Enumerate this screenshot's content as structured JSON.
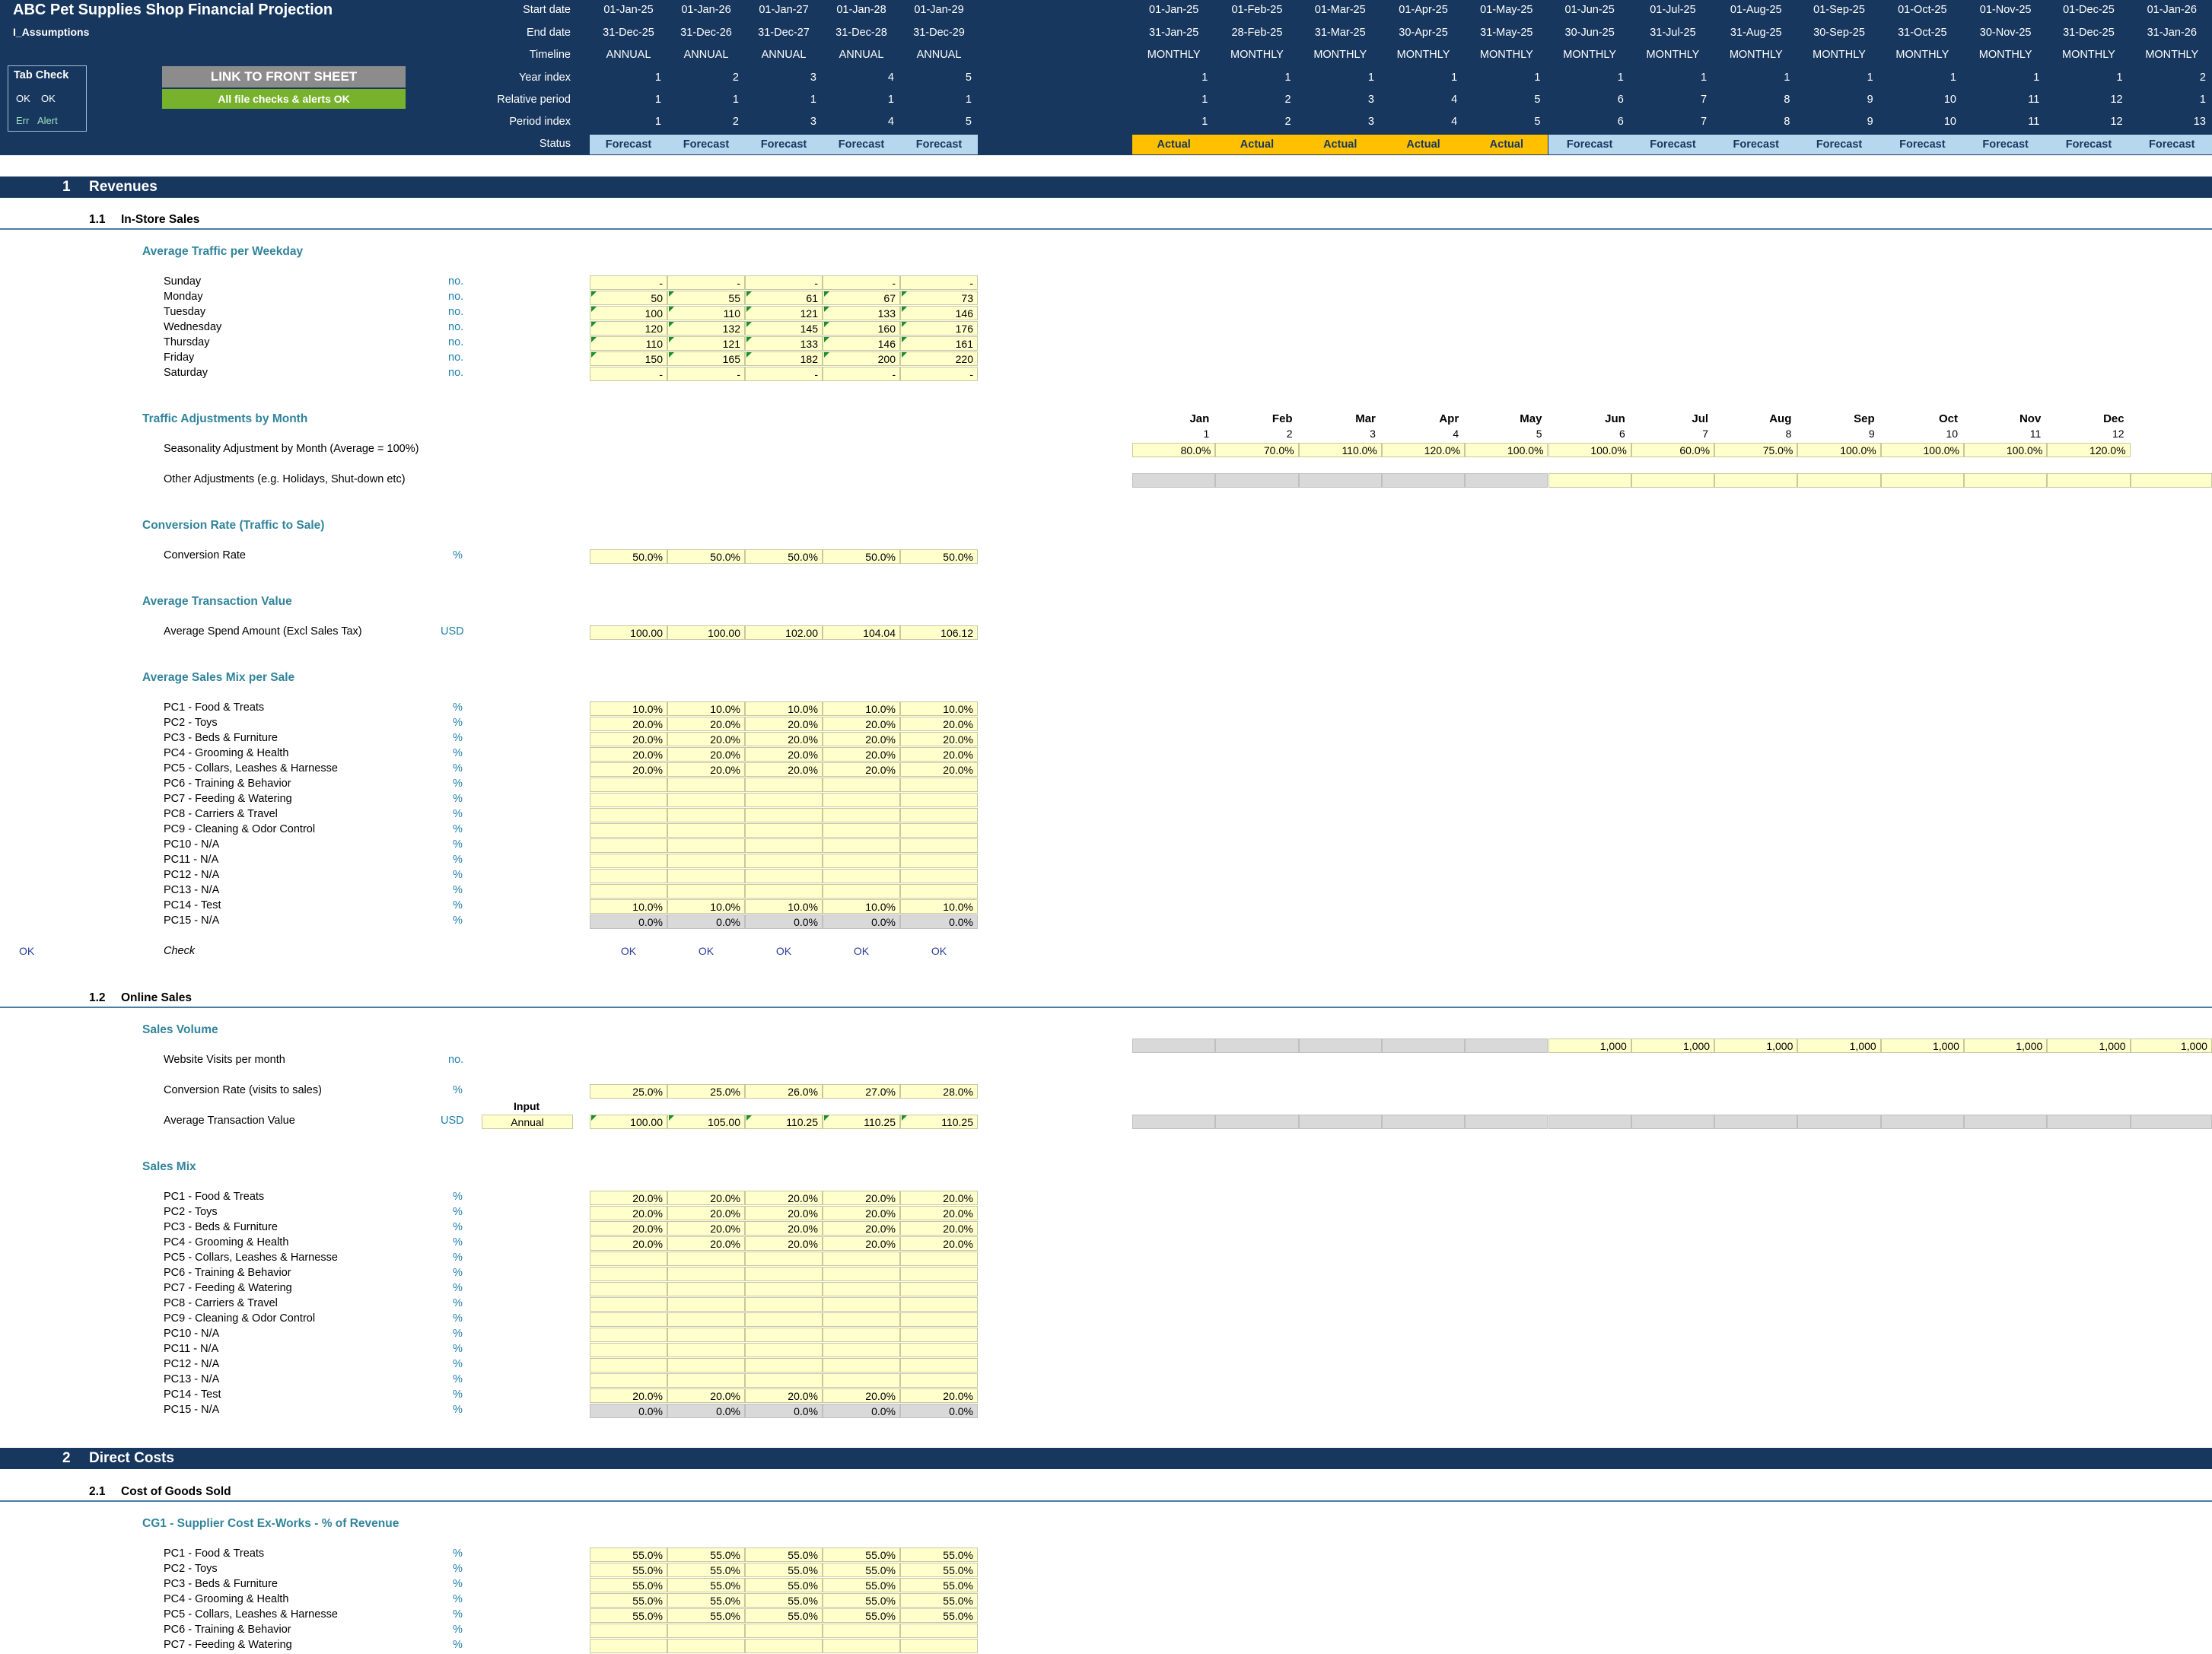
{
  "header": {
    "title": "ABC Pet Supplies Shop Financial Projection",
    "sheet": "I_Assumptions",
    "row_labels": [
      "Start date",
      "End date",
      "Timeline",
      "Year index",
      "Relative period",
      "Period index",
      "Status"
    ],
    "tab_check": {
      "title": "Tab Check",
      "ok1": "OK",
      "ok2": "OK",
      "err": "Err",
      "alert": "Alert"
    },
    "link_button": "LINK TO FRONT SHEET",
    "alerts_ok": "All file checks & alerts OK",
    "annual": [
      {
        "start": "01-Jan-25",
        "end": "31-Dec-25",
        "timeline": "ANNUAL",
        "year": "1",
        "rel": "1",
        "period": "1",
        "status": "Forecast"
      },
      {
        "start": "01-Jan-26",
        "end": "31-Dec-26",
        "timeline": "ANNUAL",
        "year": "2",
        "rel": "1",
        "period": "2",
        "status": "Forecast"
      },
      {
        "start": "01-Jan-27",
        "end": "31-Dec-27",
        "timeline": "ANNUAL",
        "year": "3",
        "rel": "1",
        "period": "3",
        "status": "Forecast"
      },
      {
        "start": "01-Jan-28",
        "end": "31-Dec-28",
        "timeline": "ANNUAL",
        "year": "4",
        "rel": "1",
        "period": "4",
        "status": "Forecast"
      },
      {
        "start": "01-Jan-29",
        "end": "31-Dec-29",
        "timeline": "ANNUAL",
        "year": "5",
        "rel": "1",
        "period": "5",
        "status": "Forecast"
      }
    ],
    "monthly": [
      {
        "start": "01-Jan-25",
        "end": "31-Jan-25",
        "timeline": "MONTHLY",
        "year": "1",
        "rel": "1",
        "period": "1",
        "status": "Actual"
      },
      {
        "start": "01-Feb-25",
        "end": "28-Feb-25",
        "timeline": "MONTHLY",
        "year": "1",
        "rel": "2",
        "period": "2",
        "status": "Actual"
      },
      {
        "start": "01-Mar-25",
        "end": "31-Mar-25",
        "timeline": "MONTHLY",
        "year": "1",
        "rel": "3",
        "period": "3",
        "status": "Actual"
      },
      {
        "start": "01-Apr-25",
        "end": "30-Apr-25",
        "timeline": "MONTHLY",
        "year": "1",
        "rel": "4",
        "period": "4",
        "status": "Actual"
      },
      {
        "start": "01-May-25",
        "end": "31-May-25",
        "timeline": "MONTHLY",
        "year": "1",
        "rel": "5",
        "period": "5",
        "status": "Actual"
      },
      {
        "start": "01-Jun-25",
        "end": "30-Jun-25",
        "timeline": "MONTHLY",
        "year": "1",
        "rel": "6",
        "period": "6",
        "status": "Forecast"
      },
      {
        "start": "01-Jul-25",
        "end": "31-Jul-25",
        "timeline": "MONTHLY",
        "year": "1",
        "rel": "7",
        "period": "7",
        "status": "Forecast"
      },
      {
        "start": "01-Aug-25",
        "end": "31-Aug-25",
        "timeline": "MONTHLY",
        "year": "1",
        "rel": "8",
        "period": "8",
        "status": "Forecast"
      },
      {
        "start": "01-Sep-25",
        "end": "30-Sep-25",
        "timeline": "MONTHLY",
        "year": "1",
        "rel": "9",
        "period": "9",
        "status": "Forecast"
      },
      {
        "start": "01-Oct-25",
        "end": "31-Oct-25",
        "timeline": "MONTHLY",
        "year": "1",
        "rel": "10",
        "period": "10",
        "status": "Forecast"
      },
      {
        "start": "01-Nov-25",
        "end": "30-Nov-25",
        "timeline": "MONTHLY",
        "year": "1",
        "rel": "11",
        "period": "11",
        "status": "Forecast"
      },
      {
        "start": "01-Dec-25",
        "end": "31-Dec-25",
        "timeline": "MONTHLY",
        "year": "1",
        "rel": "12",
        "period": "12",
        "status": "Forecast"
      },
      {
        "start": "01-Jan-26",
        "end": "31-Jan-26",
        "timeline": "MONTHLY",
        "year": "2",
        "rel": "1",
        "period": "13",
        "status": "Forecast"
      }
    ]
  },
  "s1": {
    "num": "1",
    "title": "Revenues"
  },
  "s1_1": {
    "num": "1.1",
    "title": "In-Store Sales"
  },
  "traffic": {
    "title": "Average Traffic per Weekday",
    "unit": "no.",
    "rows": [
      {
        "label": "Sunday",
        "values": [
          "-",
          "-",
          "-",
          "-",
          "-"
        ],
        "flag": false
      },
      {
        "label": "Monday",
        "values": [
          "50",
          "55",
          "61",
          "67",
          "73"
        ],
        "flag": true
      },
      {
        "label": "Tuesday",
        "values": [
          "100",
          "110",
          "121",
          "133",
          "146"
        ],
        "flag": true
      },
      {
        "label": "Wednesday",
        "values": [
          "120",
          "132",
          "145",
          "160",
          "176"
        ],
        "flag": true
      },
      {
        "label": "Thursday",
        "values": [
          "110",
          "121",
          "133",
          "146",
          "161"
        ],
        "flag": true
      },
      {
        "label": "Friday",
        "values": [
          "150",
          "165",
          "182",
          "200",
          "220"
        ],
        "flag": true
      },
      {
        "label": "Saturday",
        "values": [
          "-",
          "-",
          "-",
          "-",
          "-"
        ],
        "flag": false
      }
    ]
  },
  "traffic_adj": {
    "title": "Traffic Adjustments by Month",
    "months": [
      "Jan",
      "Feb",
      "Mar",
      "Apr",
      "May",
      "Jun",
      "Jul",
      "Aug",
      "Sep",
      "Oct",
      "Nov",
      "Dec"
    ],
    "month_nums": [
      "1",
      "2",
      "3",
      "4",
      "5",
      "6",
      "7",
      "8",
      "9",
      "10",
      "11",
      "12"
    ],
    "seasonality_label": "Seasonality Adjustment by Month  (Average = 100%)",
    "seasonality": [
      "80.0%",
      "70.0%",
      "110.0%",
      "120.0%",
      "100.0%",
      "100.0%",
      "60.0%",
      "75.0%",
      "100.0%",
      "100.0%",
      "100.0%",
      "120.0%"
    ],
    "other_label": "Other Adjustments (e.g. Holidays, Shut-down etc)"
  },
  "conversion": {
    "title": "Conversion Rate (Traffic to Sale)",
    "label": "Conversion Rate",
    "unit": "%",
    "values": [
      "50.0%",
      "50.0%",
      "50.0%",
      "50.0%",
      "50.0%"
    ]
  },
  "atv": {
    "title": "Average Transaction Value",
    "label": "Average Spend Amount (Excl Sales Tax)",
    "unit": "USD",
    "values": [
      "100.00",
      "100.00",
      "102.00",
      "104.04",
      "106.12"
    ]
  },
  "mix_labels": [
    "PC1 - Food & Treats",
    "PC2 - Toys",
    "PC3 - Beds & Furniture",
    "PC4 - Grooming & Health",
    "PC5 - Collars, Leashes & Harnesse",
    "PC6 - Training & Behavior",
    "PC7 - Feeding & Watering",
    "PC8 - Carriers & Travel",
    "PC9 - Cleaning & Odor Control",
    "PC10 - N/A",
    "PC11 - N/A",
    "PC12 - N/A",
    "PC13 - N/A",
    "PC14 - Test",
    "PC15 - N/A"
  ],
  "store_mix": {
    "title": "Average Sales Mix per Sale",
    "unit": "%",
    "values": [
      [
        "10.0%",
        "10.0%",
        "10.0%",
        "10.0%",
        "10.0%"
      ],
      [
        "20.0%",
        "20.0%",
        "20.0%",
        "20.0%",
        "20.0%"
      ],
      [
        "20.0%",
        "20.0%",
        "20.0%",
        "20.0%",
        "20.0%"
      ],
      [
        "20.0%",
        "20.0%",
        "20.0%",
        "20.0%",
        "20.0%"
      ],
      [
        "20.0%",
        "20.0%",
        "20.0%",
        "20.0%",
        "20.0%"
      ],
      [
        "",
        "",
        "",
        "",
        ""
      ],
      [
        "",
        "",
        "",
        "",
        ""
      ],
      [
        "",
        "",
        "",
        "",
        ""
      ],
      [
        "",
        "",
        "",
        "",
        ""
      ],
      [
        "",
        "",
        "",
        "",
        ""
      ],
      [
        "",
        "",
        "",
        "",
        ""
      ],
      [
        "",
        "",
        "",
        "",
        ""
      ],
      [
        "",
        "",
        "",
        "",
        ""
      ],
      [
        "10.0%",
        "10.0%",
        "10.0%",
        "10.0%",
        "10.0%"
      ],
      [
        "0.0%",
        "0.0%",
        "0.0%",
        "0.0%",
        "0.0%"
      ]
    ],
    "check_label": "Check",
    "check_left": "OK",
    "checks": [
      "OK",
      "OK",
      "OK",
      "OK",
      "OK"
    ]
  },
  "s1_2": {
    "num": "1.2",
    "title": "Online Sales"
  },
  "online": {
    "title": "Sales Volume",
    "visits_label": "Website Visits per month",
    "visits_unit": "no.",
    "visits_monthly": [
      "",
      "",
      "",
      "",
      "",
      "1,000",
      "1,000",
      "1,000",
      "1,000",
      "1,000",
      "1,000",
      "1,000",
      "1,000"
    ],
    "conv_label": "Conversion Rate (visits to sales)",
    "conv_unit": "%",
    "conv_values": [
      "25.0%",
      "25.0%",
      "26.0%",
      "27.0%",
      "28.0%"
    ],
    "input_label": "Input",
    "input_value": "Annual",
    "atv_label": "Average Transaction Value",
    "atv_unit": "USD",
    "atv_values": [
      "100.00",
      "105.00",
      "110.25",
      "110.25",
      "110.25"
    ]
  },
  "online_mix": {
    "title": "Sales Mix",
    "unit": "%",
    "values": [
      [
        "20.0%",
        "20.0%",
        "20.0%",
        "20.0%",
        "20.0%"
      ],
      [
        "20.0%",
        "20.0%",
        "20.0%",
        "20.0%",
        "20.0%"
      ],
      [
        "20.0%",
        "20.0%",
        "20.0%",
        "20.0%",
        "20.0%"
      ],
      [
        "20.0%",
        "20.0%",
        "20.0%",
        "20.0%",
        "20.0%"
      ],
      [
        "",
        "",
        "",
        "",
        ""
      ],
      [
        "",
        "",
        "",
        "",
        ""
      ],
      [
        "",
        "",
        "",
        "",
        ""
      ],
      [
        "",
        "",
        "",
        "",
        ""
      ],
      [
        "",
        "",
        "",
        "",
        ""
      ],
      [
        "",
        "",
        "",
        "",
        ""
      ],
      [
        "",
        "",
        "",
        "",
        ""
      ],
      [
        "",
        "",
        "",
        "",
        ""
      ],
      [
        "",
        "",
        "",
        "",
        ""
      ],
      [
        "20.0%",
        "20.0%",
        "20.0%",
        "20.0%",
        "20.0%"
      ],
      [
        "0.0%",
        "0.0%",
        "0.0%",
        "0.0%",
        "0.0%"
      ]
    ]
  },
  "s2": {
    "num": "2",
    "title": "Direct Costs"
  },
  "s2_1": {
    "num": "2.1",
    "title": "Cost of Goods Sold"
  },
  "cogs": {
    "title": "CG1 - Supplier Cost Ex-Works - % of Revenue",
    "unit": "%",
    "values": [
      [
        "55.0%",
        "55.0%",
        "55.0%",
        "55.0%",
        "55.0%"
      ],
      [
        "55.0%",
        "55.0%",
        "55.0%",
        "55.0%",
        "55.0%"
      ],
      [
        "55.0%",
        "55.0%",
        "55.0%",
        "55.0%",
        "55.0%"
      ],
      [
        "55.0%",
        "55.0%",
        "55.0%",
        "55.0%",
        "55.0%"
      ],
      [
        "55.0%",
        "55.0%",
        "55.0%",
        "55.0%",
        "55.0%"
      ],
      [
        "",
        "",
        "",
        "",
        ""
      ],
      [
        "",
        "",
        "",
        "",
        ""
      ]
    ]
  }
}
